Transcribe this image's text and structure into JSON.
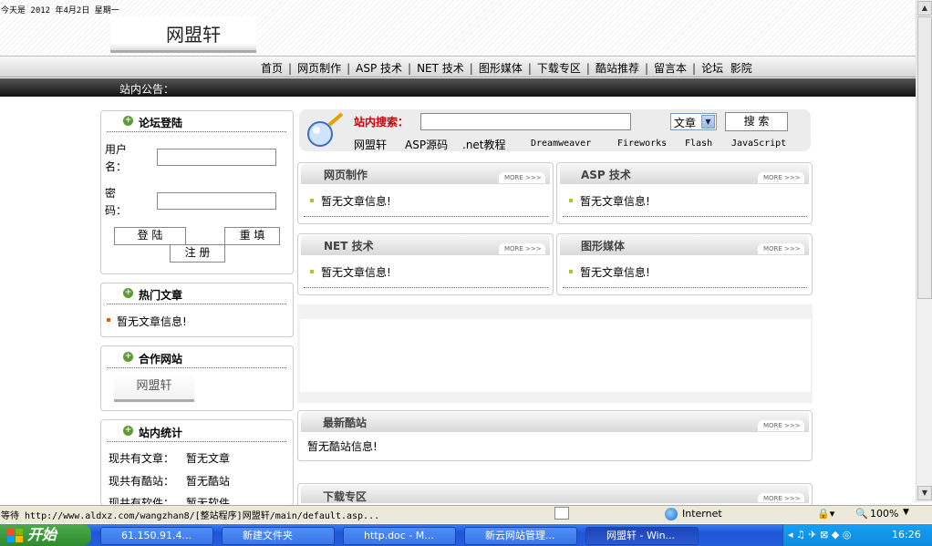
{
  "header": {
    "date_text": "今天是 2012 年4月2日 星期一",
    "logo": "网盟轩",
    "nav": [
      "首页",
      "网页制作",
      "ASP 技术",
      "NET 技术",
      "图形媒体",
      "下载专区",
      "酷站推荐",
      "留言本",
      "论坛",
      "影院"
    ],
    "notice_label": "站内公告："
  },
  "login": {
    "title": "论坛登陆",
    "user_label_1": "用户",
    "user_label_2": "名：",
    "pass_label_1": "密",
    "pass_label_2": "码：",
    "login_btn": "登 陆",
    "reset_btn": "重 填",
    "register_btn": "注 册"
  },
  "hot": {
    "title": "热门文章",
    "empty": "暂无文章信息!"
  },
  "partners": {
    "title": "合作网站",
    "logo": "网盟轩"
  },
  "stats": {
    "title": "站内统计",
    "rows": [
      {
        "label": "现共有文章：",
        "value": "暂无文章"
      },
      {
        "label": "现共有酷站：",
        "value": "暂无酷站"
      },
      {
        "label": "现共有软件：",
        "value": "暂无软件"
      }
    ]
  },
  "search": {
    "label": "站内搜索：",
    "select_value": "文章",
    "button": "搜 索",
    "links": [
      "网盟轩",
      "ASP源码",
      ".net教程",
      "Dreamweaver",
      "Fireworks",
      "Flash",
      "JavaScript"
    ]
  },
  "panels": [
    {
      "title": "网页制作",
      "more": "MORE >>>",
      "empty": "暂无文章信息!"
    },
    {
      "title": "ASP 技术",
      "more": "MORE >>>",
      "empty": "暂无文章信息!"
    },
    {
      "title": "NET 技术",
      "more": "MORE >>>",
      "empty": "暂无文章信息!"
    },
    {
      "title": "图形媒体",
      "more": "MORE >>>",
      "empty": "暂无文章信息!"
    }
  ],
  "coolsites": {
    "title": "最新酷站",
    "more": "MORE >>>",
    "empty": "暂无酷站信息!"
  },
  "downloads": {
    "title": "下载专区",
    "more": "MORE >>>"
  },
  "statusbar": {
    "text": "等待 http://www.aldxz.com/wangzhan8/[整站程序]网盟轩/main/default.asp...",
    "zone": "Internet",
    "zoom": "100%"
  },
  "taskbar": {
    "start": "开始",
    "items": [
      "61.150.91.4...",
      "新建文件夹",
      "http.doc - M...",
      "新云网站管理...",
      "网盟轩 - Win..."
    ],
    "clock": "16:26"
  }
}
